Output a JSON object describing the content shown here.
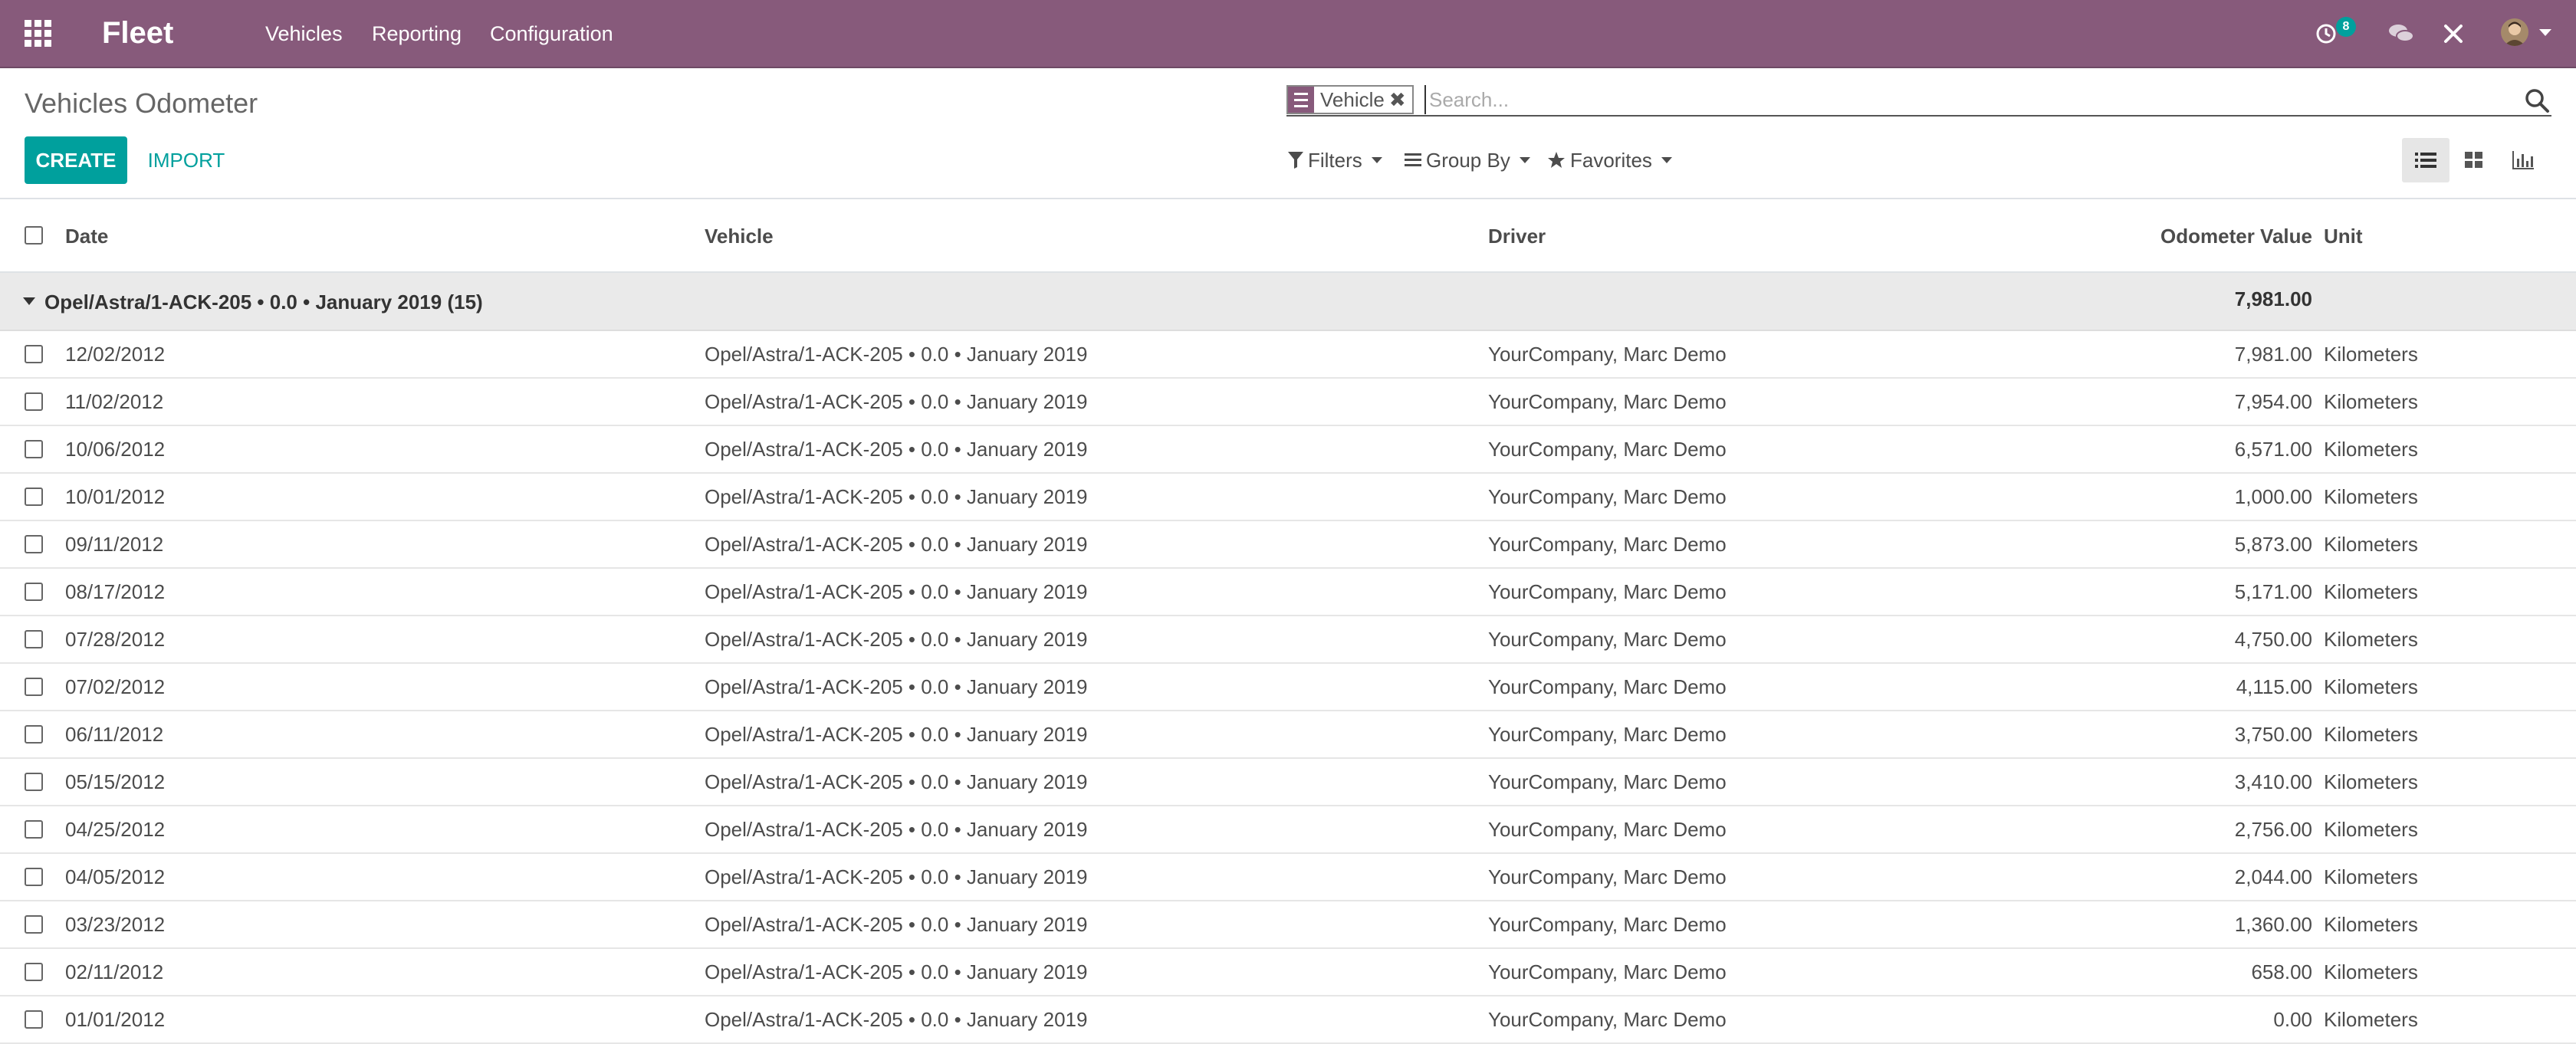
{
  "navbar": {
    "brand": "Fleet",
    "menu": [
      "Vehicles",
      "Reporting",
      "Configuration"
    ],
    "activity_count": "8",
    "icons": [
      "apps-grid-icon",
      "activity-clock-icon",
      "chat-bubbles-icon",
      "debug-tools-icon",
      "user-avatar",
      "caret-down-icon"
    ]
  },
  "control_panel": {
    "title": "Vehicles Odometer",
    "create_label": "CREATE",
    "import_label": "IMPORT",
    "search": {
      "facet_icon": "group-by-list-icon",
      "facet_value": "Vehicle",
      "placeholder": "Search..."
    },
    "filters_label": "Filters",
    "group_by_label": "Group By",
    "favorites_label": "Favorites",
    "views": [
      "list-view-icon",
      "kanban-view-icon",
      "graph-view-icon"
    ],
    "active_view": "list"
  },
  "table": {
    "headers": {
      "date": "Date",
      "vehicle": "Vehicle",
      "driver": "Driver",
      "odometer": "Odometer Value",
      "unit": "Unit"
    },
    "group": {
      "label": "Opel/Astra/1-ACK-205 • 0.0 • January 2019 (15)",
      "total": "7,981.00"
    },
    "rows": [
      {
        "date": "12/02/2012",
        "vehicle": "Opel/Astra/1-ACK-205 • 0.0 • January 2019",
        "driver": "YourCompany, Marc Demo",
        "odometer": "7,981.00",
        "unit": "Kilometers"
      },
      {
        "date": "11/02/2012",
        "vehicle": "Opel/Astra/1-ACK-205 • 0.0 • January 2019",
        "driver": "YourCompany, Marc Demo",
        "odometer": "7,954.00",
        "unit": "Kilometers"
      },
      {
        "date": "10/06/2012",
        "vehicle": "Opel/Astra/1-ACK-205 • 0.0 • January 2019",
        "driver": "YourCompany, Marc Demo",
        "odometer": "6,571.00",
        "unit": "Kilometers"
      },
      {
        "date": "10/01/2012",
        "vehicle": "Opel/Astra/1-ACK-205 • 0.0 • January 2019",
        "driver": "YourCompany, Marc Demo",
        "odometer": "1,000.00",
        "unit": "Kilometers"
      },
      {
        "date": "09/11/2012",
        "vehicle": "Opel/Astra/1-ACK-205 • 0.0 • January 2019",
        "driver": "YourCompany, Marc Demo",
        "odometer": "5,873.00",
        "unit": "Kilometers"
      },
      {
        "date": "08/17/2012",
        "vehicle": "Opel/Astra/1-ACK-205 • 0.0 • January 2019",
        "driver": "YourCompany, Marc Demo",
        "odometer": "5,171.00",
        "unit": "Kilometers"
      },
      {
        "date": "07/28/2012",
        "vehicle": "Opel/Astra/1-ACK-205 • 0.0 • January 2019",
        "driver": "YourCompany, Marc Demo",
        "odometer": "4,750.00",
        "unit": "Kilometers"
      },
      {
        "date": "07/02/2012",
        "vehicle": "Opel/Astra/1-ACK-205 • 0.0 • January 2019",
        "driver": "YourCompany, Marc Demo",
        "odometer": "4,115.00",
        "unit": "Kilometers"
      },
      {
        "date": "06/11/2012",
        "vehicle": "Opel/Astra/1-ACK-205 • 0.0 • January 2019",
        "driver": "YourCompany, Marc Demo",
        "odometer": "3,750.00",
        "unit": "Kilometers"
      },
      {
        "date": "05/15/2012",
        "vehicle": "Opel/Astra/1-ACK-205 • 0.0 • January 2019",
        "driver": "YourCompany, Marc Demo",
        "odometer": "3,410.00",
        "unit": "Kilometers"
      },
      {
        "date": "04/25/2012",
        "vehicle": "Opel/Astra/1-ACK-205 • 0.0 • January 2019",
        "driver": "YourCompany, Marc Demo",
        "odometer": "2,756.00",
        "unit": "Kilometers"
      },
      {
        "date": "04/05/2012",
        "vehicle": "Opel/Astra/1-ACK-205 • 0.0 • January 2019",
        "driver": "YourCompany, Marc Demo",
        "odometer": "2,044.00",
        "unit": "Kilometers"
      },
      {
        "date": "03/23/2012",
        "vehicle": "Opel/Astra/1-ACK-205 • 0.0 • January 2019",
        "driver": "YourCompany, Marc Demo",
        "odometer": "1,360.00",
        "unit": "Kilometers"
      },
      {
        "date": "02/11/2012",
        "vehicle": "Opel/Astra/1-ACK-205 • 0.0 • January 2019",
        "driver": "YourCompany, Marc Demo",
        "odometer": "658.00",
        "unit": "Kilometers"
      },
      {
        "date": "01/01/2012",
        "vehicle": "Opel/Astra/1-ACK-205 • 0.0 • January 2019",
        "driver": "YourCompany, Marc Demo",
        "odometer": "0.00",
        "unit": "Kilometers"
      }
    ]
  },
  "colors": {
    "brand": "#875a7b",
    "accent": "#00a09d",
    "group_bg": "#eaeaea"
  }
}
